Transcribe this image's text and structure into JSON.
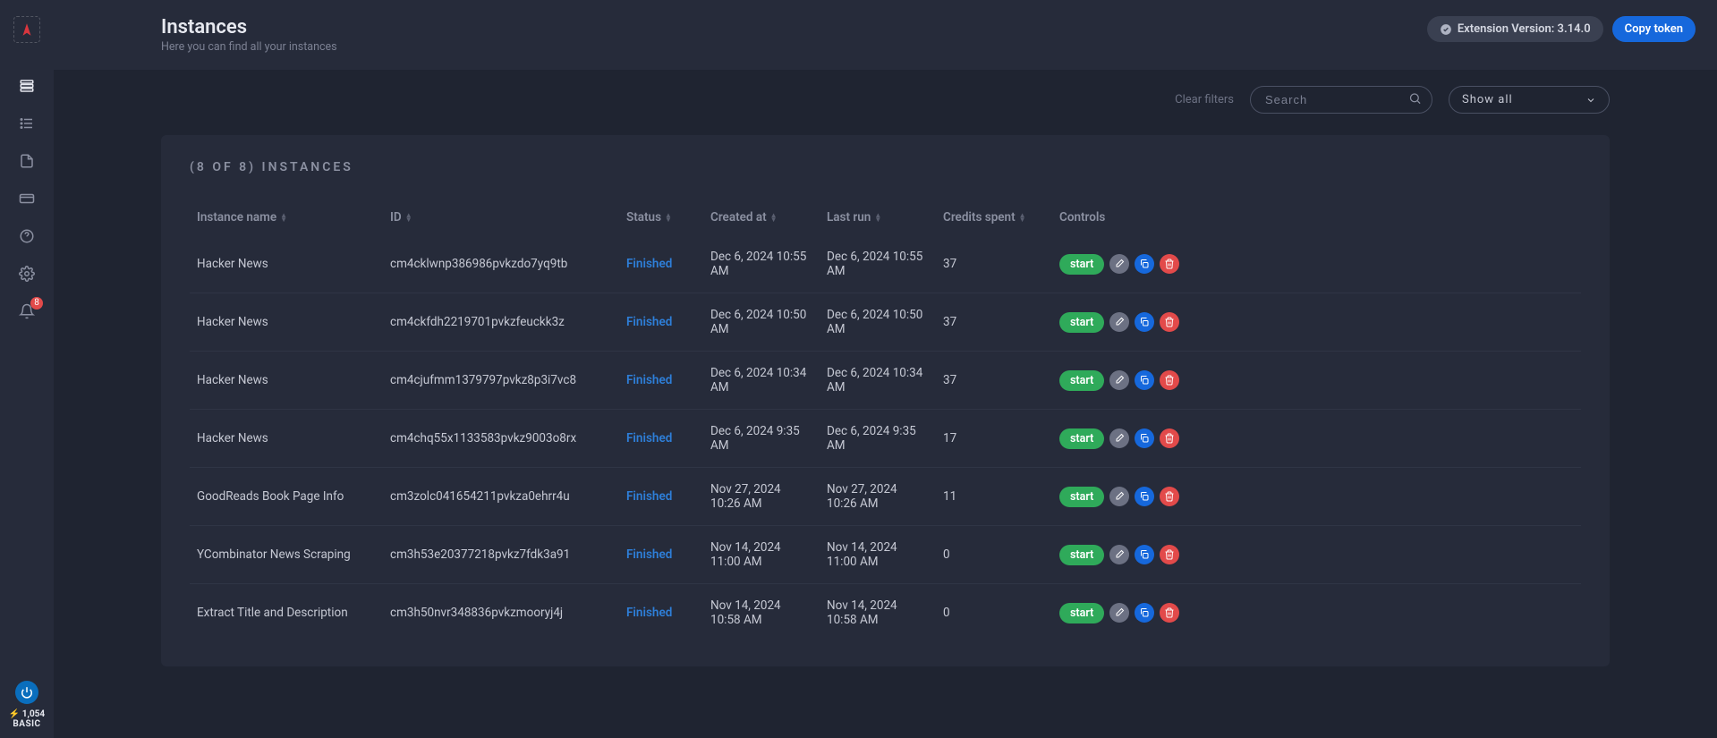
{
  "header": {
    "title": "Instances",
    "subtitle": "Here you can find all your instances",
    "extension_label": "Extension Version: 3.14.0",
    "copy_token_label": "Copy token"
  },
  "filters": {
    "clear_label": "Clear filters",
    "search_placeholder": "Search",
    "show_selected": "Show all"
  },
  "table": {
    "count_label": "(8 OF 8) INSTANCES",
    "columns": {
      "name": "Instance name",
      "id": "ID",
      "status": "Status",
      "created": "Created at",
      "last_run": "Last run",
      "credits": "Credits spent",
      "controls": "Controls"
    },
    "start_label": "start",
    "rows": [
      {
        "name": "Hacker News",
        "id": "cm4cklwnp386986pvkzdo7yq9tb",
        "status": "Finished",
        "created": "Dec 6, 2024 10:55 AM",
        "last_run": "Dec 6, 2024 10:55 AM",
        "credits": "37"
      },
      {
        "name": "Hacker News",
        "id": "cm4ckfdh2219701pvkzfeuckk3z",
        "status": "Finished",
        "created": "Dec 6, 2024 10:50 AM",
        "last_run": "Dec 6, 2024 10:50 AM",
        "credits": "37"
      },
      {
        "name": "Hacker News",
        "id": "cm4cjufmm1379797pvkz8p3i7vc8",
        "status": "Finished",
        "created": "Dec 6, 2024 10:34 AM",
        "last_run": "Dec 6, 2024 10:34 AM",
        "credits": "37"
      },
      {
        "name": "Hacker News",
        "id": "cm4chq55x1133583pvkz9003o8rx",
        "status": "Finished",
        "created": "Dec 6, 2024 9:35 AM",
        "last_run": "Dec 6, 2024 9:35 AM",
        "credits": "17"
      },
      {
        "name": "GoodReads Book Page Info",
        "id": "cm3zolc041654211pvkza0ehrr4u",
        "status": "Finished",
        "created": "Nov 27, 2024 10:26 AM",
        "last_run": "Nov 27, 2024 10:26 AM",
        "credits": "11"
      },
      {
        "name": "YCombinator News Scraping",
        "id": "cm3h53e20377218pvkz7fdk3a91",
        "status": "Finished",
        "created": "Nov 14, 2024 11:00 AM",
        "last_run": "Nov 14, 2024 11:00 AM",
        "credits": "0"
      },
      {
        "name": "Extract Title and Description",
        "id": "cm3h50nvr348836pvkzmooryj4j",
        "status": "Finished",
        "created": "Nov 14, 2024 10:58 AM",
        "last_run": "Nov 14, 2024 10:58 AM",
        "credits": "0"
      }
    ]
  },
  "sidebar": {
    "notifications_badge": "8",
    "credits": "⚡ 1,054",
    "plan": "BASIC"
  }
}
